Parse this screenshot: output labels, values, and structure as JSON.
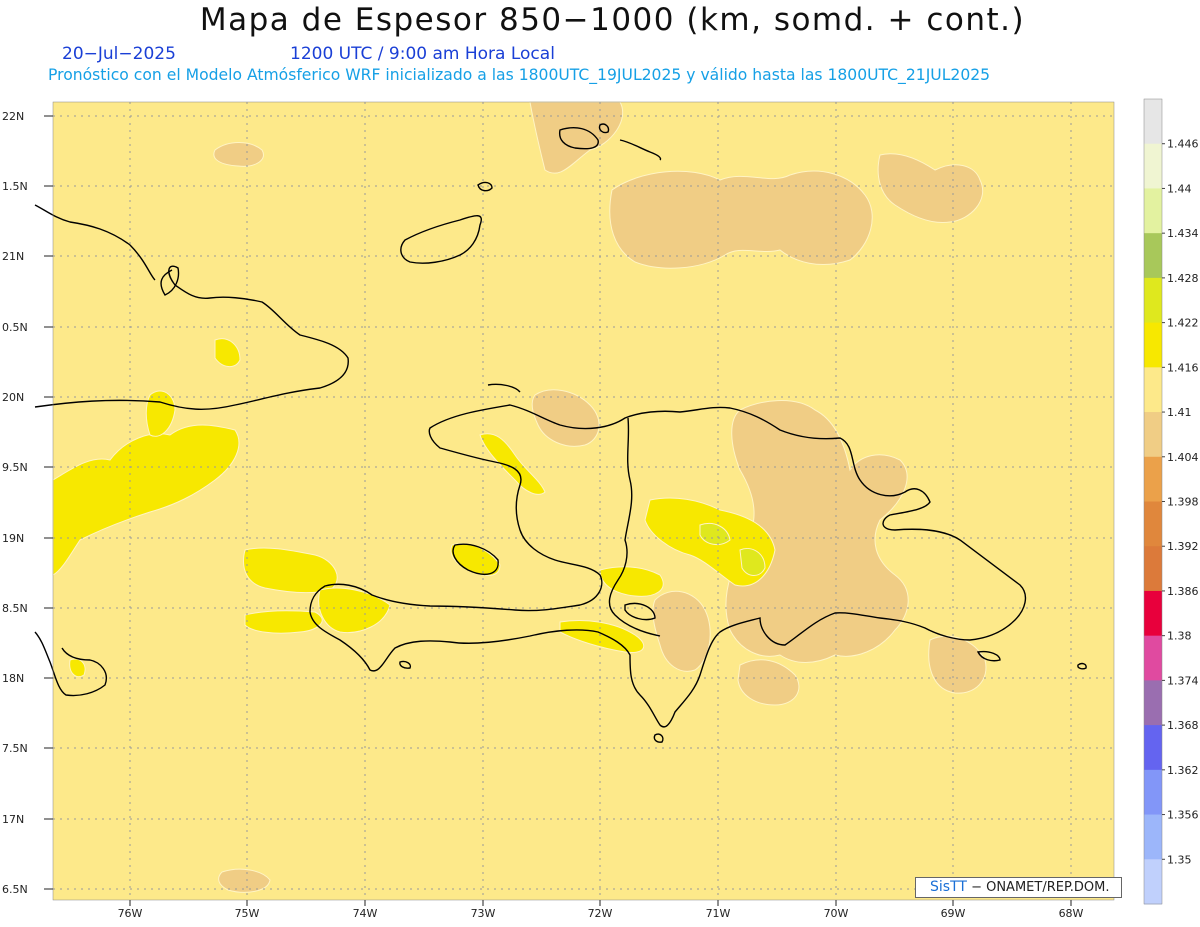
{
  "title": "Mapa de Espesor 850−1000 (km, somd. + cont.)",
  "date": "20−Jul−2025",
  "time": "1200 UTC / 9:00 am Hora Local",
  "subtitle": "Pronóstico con el Modelo Atmósferico WRF inicializado a las 1800UTC_19JUL2025 y válido hasta las  1800UTC_21JUL2025",
  "credit": {
    "logo": "SisTT",
    "text": "− ONAMET/REP.DOM."
  },
  "axes": {
    "lat_labels": [
      "22N",
      "1.5N",
      "21N",
      "0.5N",
      "20N",
      "9.5N",
      "19N",
      "8.5N",
      "18N",
      "7.5N",
      "17N",
      "6.5N"
    ],
    "lon_labels": [
      "76W",
      "75W",
      "74W",
      "73W",
      "72W",
      "71W",
      "70W",
      "69W",
      "68W"
    ]
  },
  "colorbar": {
    "labels": [
      "1.446",
      "1.44",
      "1.434",
      "1.428",
      "1.422",
      "1.416",
      "1.41",
      "1.404",
      "1.398",
      "1.392",
      "1.386",
      "1.38",
      "1.374",
      "1.368",
      "1.362",
      "1.356",
      "1.35"
    ],
    "colors": [
      "#e6e6e6",
      "#f0f5d2",
      "#e3f2a0",
      "#a8c85a",
      "#dfe81e",
      "#f7e800",
      "#fde98a",
      "#f0cd85",
      "#eba14a",
      "#e0873c",
      "#dc7a3a",
      "#e8003c",
      "#e04aa0",
      "#9a6eb0",
      "#6464f0",
      "#8296f8",
      "#9cb6fa",
      "#c0d0fc"
    ]
  },
  "colors": {
    "background": "#fde98a",
    "thickness_low": "#f0cd85",
    "thickness_high": "#f7e800",
    "thickness_peak": "#dfe81e",
    "coastline": "#000000"
  }
}
